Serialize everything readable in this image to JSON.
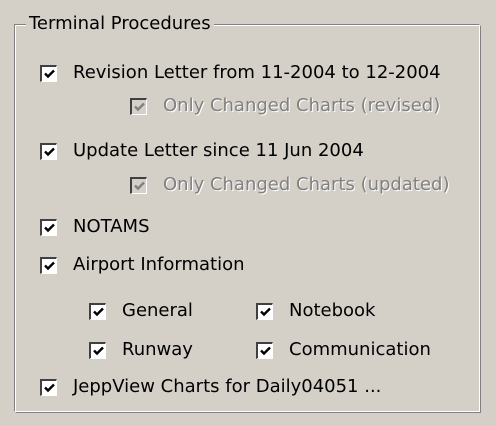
{
  "group": {
    "title": "Terminal Procedures"
  },
  "options": {
    "revision_letter": {
      "label": "Revision Letter from 11-2004 to 12-2004",
      "checked": true
    },
    "revision_only_changed": {
      "label": "Only Changed Charts (revised)",
      "checked": true,
      "enabled": false
    },
    "update_letter": {
      "label": "Update Letter since 11 Jun 2004",
      "checked": true
    },
    "update_only_changed": {
      "label": "Only Changed Charts (updated)",
      "checked": true,
      "enabled": false
    },
    "notams": {
      "label": "NOTAMS",
      "checked": true
    },
    "airport_information": {
      "label": "Airport Information",
      "checked": true
    },
    "general": {
      "label": "General",
      "checked": true
    },
    "notebook": {
      "label": "Notebook",
      "checked": true
    },
    "runway": {
      "label": "Runway",
      "checked": true
    },
    "communication": {
      "label": "Communication",
      "checked": true
    },
    "jeppview_charts": {
      "label": "JeppView Charts for Daily04051 ...",
      "checked": true
    }
  },
  "colors": {
    "face": "#d4d0c8",
    "disabled_text": "#808080",
    "check_mark": "#000000",
    "disabled_check_mark": "#808080"
  },
  "icons": {
    "checkbox_checked": "check-mark-icon"
  }
}
